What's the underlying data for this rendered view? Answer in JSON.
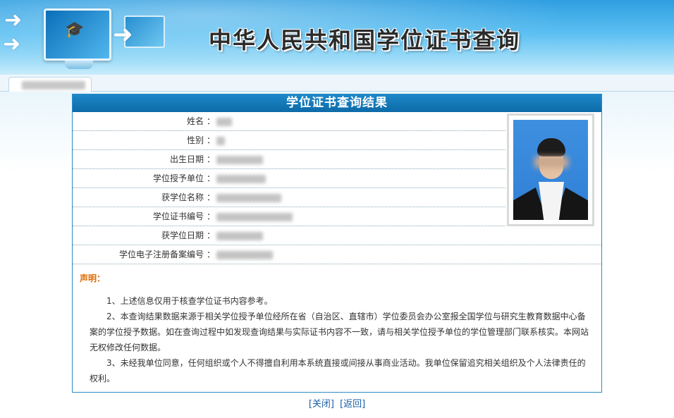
{
  "header": {
    "title": "中华人民共和国学位证书查询",
    "icons": [
      "monitor-icon",
      "arrow-icon",
      "graduation-cap-icon"
    ]
  },
  "tab": {
    "label_redacted": true
  },
  "result": {
    "title": "学位证书查询结果",
    "fields": [
      {
        "label": "姓名",
        "colon": "："
      },
      {
        "label": "性别",
        "colon": "："
      },
      {
        "label": "出生日期",
        "colon": "："
      },
      {
        "label": "学位授予单位",
        "colon": "："
      },
      {
        "label": "获学位名称",
        "colon": "："
      },
      {
        "label": "学位证书编号",
        "colon": "："
      },
      {
        "label": "获学位日期",
        "colon": "："
      },
      {
        "label": "学位电子注册备案编号",
        "colon": "："
      }
    ],
    "statement": {
      "title": "声明：",
      "items": [
        "1、上述信息仅用于核查学位证书内容参考。",
        "2、本查询结果数据来源于相关学位授予单位经所在省（自治区、直辖市）学位委员会办公室报全国学位与研究生教育数据中心备案的学位授予数据。如在查询过程中如发现查询结果与实际证书内容不一致，请与相关学位授予单位的学位管理部门联系核实。本网站无权修改任何数据。",
        "3、未经我单位同意，任何组织或个人不得擅自利用本系统直接或间接从事商业活动。我单位保留追究相关组织及个人法律责任的权利。"
      ]
    }
  },
  "footer": {
    "close_label": "[关闭]",
    "back_label": "[返回]"
  },
  "colors": {
    "header_bar": "#0d6aa8",
    "statement_title": "#e06a00",
    "link": "#1a5fa8"
  }
}
